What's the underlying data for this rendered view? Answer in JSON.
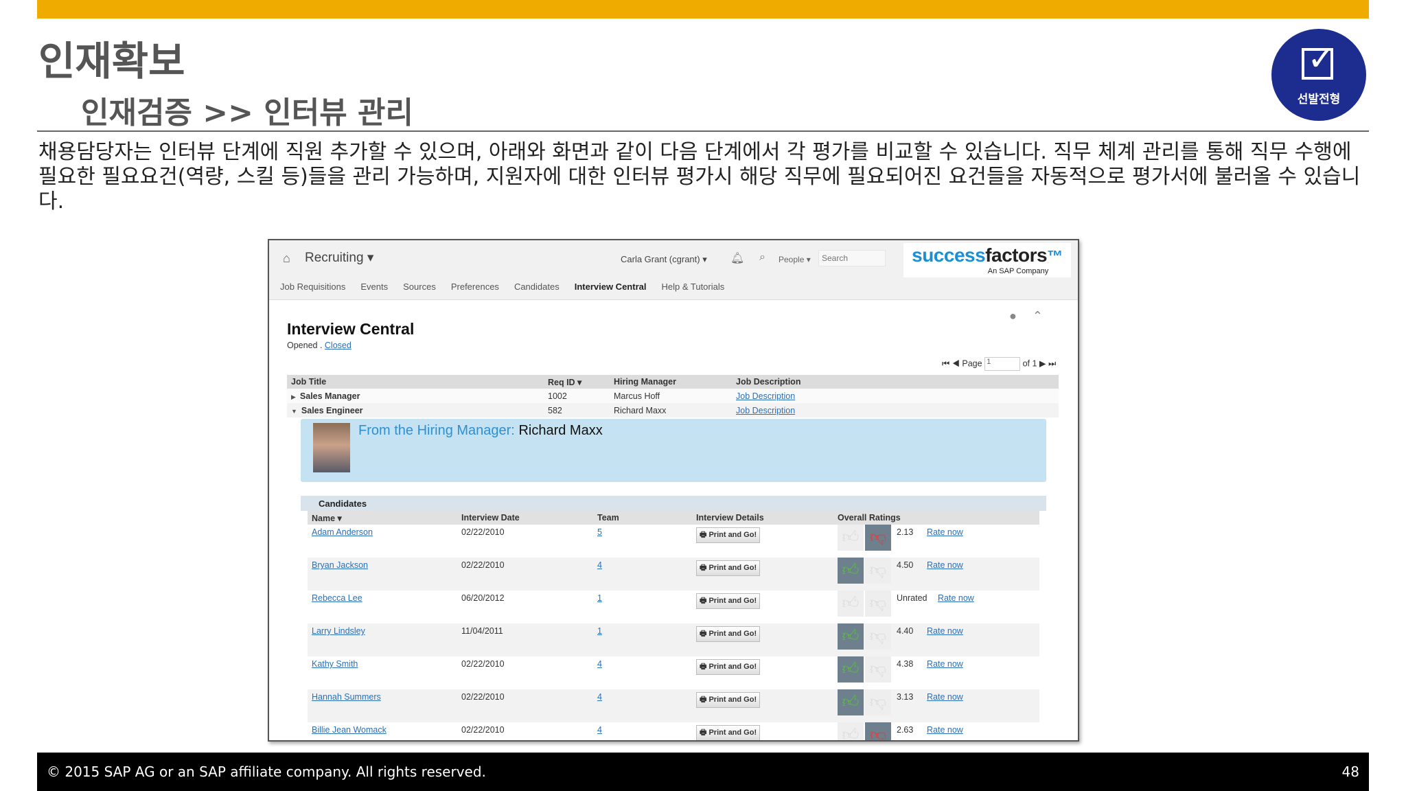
{
  "slide": {
    "title": "인재확보",
    "subtitle": "인재검증 >> 인터뷰 관리",
    "badge_label": "선발전형",
    "paragraph": "채용담당자는 인터뷰 단계에 직원 추가할 수 있으며, 아래와 화면과 같이 다음 단계에서 각 평가를 비교할 수 있습니다. 직무 체계 관리를 통해 직무 수행에 필요한 필요요건(역량, 스킬 등)들을 관리 가능하며, 지원자에 대한 인터뷰 평가시 해당 직무에 필요되어진 요건들을 자동적으로 평가서에 불러올 수 있습니다.",
    "footer_text": "© 2015 SAP AG or an SAP affiliate company. All rights reserved.",
    "page_number": "48",
    "accent_color": "#f0ab00",
    "badge_color": "#1c2d8f"
  },
  "app": {
    "home_icon": "home-icon",
    "module": "Recruiting ▾",
    "user": "Carla Grant (cgrant) ▾",
    "people": "People ▾",
    "search_placeholder": "Search",
    "logo_success": "success",
    "logo_factors": "factors",
    "logo_tm": "™",
    "logo_sub": "An SAP Company",
    "nav": [
      "Job Requisitions",
      "Events",
      "Sources",
      "Preferences",
      "Candidates",
      "Interview Central",
      "Help & Tutorials"
    ],
    "active_nav": "Interview Central"
  },
  "interview": {
    "title": "Interview Central",
    "opened": "Opened",
    "closed": "Closed",
    "page_label": "Page",
    "page_value": "1",
    "of_label": "of 1",
    "job_headers": [
      "Job Title",
      "Req ID ▾",
      "Hiring Manager",
      "Job Description"
    ],
    "jobs": [
      {
        "toggle": "▶",
        "title": "Sales Manager",
        "req": "1002",
        "manager": "Marcus Hoff",
        "desc": "Job Description"
      },
      {
        "toggle": "▼",
        "title": "Sales Engineer",
        "req": "582",
        "manager": "Richard Maxx",
        "desc": "Job Description"
      }
    ],
    "hm_label": "From the Hiring Manager:",
    "hm_name": "Richard Maxx",
    "candidates_label": "Candidates",
    "cand_headers": [
      "Name ▾",
      "Interview Date",
      "Team",
      "Interview Details",
      "Overall Ratings"
    ],
    "print_label": "Print and Go!",
    "rate_label": "Rate now",
    "candidates": [
      {
        "name": "Adam Anderson",
        "date": "02/22/2010",
        "team": "5",
        "rating": "2.13",
        "thumb": "down"
      },
      {
        "name": "Bryan Jackson",
        "date": "02/22/2010",
        "team": "4",
        "rating": "4.50",
        "thumb": "up"
      },
      {
        "name": "Rebecca Lee",
        "date": "06/20/2012",
        "team": "1",
        "rating": "Unrated",
        "thumb": "none"
      },
      {
        "name": "Larry Lindsley",
        "date": "11/04/2011",
        "team": "1",
        "rating": "4.40",
        "thumb": "up"
      },
      {
        "name": "Kathy Smith",
        "date": "02/22/2010",
        "team": "4",
        "rating": "4.38",
        "thumb": "up"
      },
      {
        "name": "Hannah Summers",
        "date": "02/22/2010",
        "team": "4",
        "rating": "3.13",
        "thumb": "up"
      },
      {
        "name": "Billie Jean Womack",
        "date": "02/22/2010",
        "team": "4",
        "rating": "2.63",
        "thumb": "down"
      }
    ]
  }
}
